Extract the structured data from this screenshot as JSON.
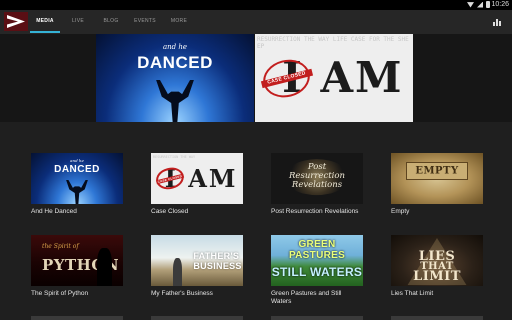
{
  "status_bar": {
    "time": "10:26",
    "icons": [
      "wifi-icon",
      "signal-icon",
      "battery-icon"
    ]
  },
  "app_bar": {
    "logo": "app-logo-icon",
    "tabs": [
      {
        "label": "MEDIA",
        "active": true
      },
      {
        "label": "LIVE",
        "active": false
      },
      {
        "label": "BLOG",
        "active": false
      },
      {
        "label": "EVENTS",
        "active": false
      },
      {
        "label": "MORE",
        "active": false
      }
    ],
    "action_icon": "bar-chart-icon",
    "accent_color": "#35b2d5"
  },
  "featured": [
    {
      "art_small": "and he",
      "art_big": "DANCED"
    },
    {
      "art_big": "I AM",
      "stamp": "CASE CLOSED",
      "background_words": "RESURRECTION THE WAY LIFE CASE FOR THE SHEEP"
    }
  ],
  "media_items": [
    {
      "title": "And He Danced",
      "art_small": "and he",
      "art_big": "DANCED"
    },
    {
      "title": "Case Closed",
      "art_big": "I AM",
      "stamp": "CASE CLOSED",
      "background_words": "RESURRECTION THE WAY"
    },
    {
      "title": "Post Resurrection Revelations",
      "art_lines": [
        "Post",
        "Resurrection",
        "Revelations"
      ]
    },
    {
      "title": "Empty",
      "art_big": "EMPTY"
    },
    {
      "title": "The Spirit of Python",
      "art_small": "the Spirit of",
      "art_big": "PYTHON"
    },
    {
      "title": "My Father's Business",
      "art_lines": [
        "FATHER'S",
        "BUSINESS"
      ]
    },
    {
      "title": "Green Pastures and Still Waters",
      "art_lines": [
        "GREEN PASTURES",
        "STILL WATERS"
      ]
    },
    {
      "title": "Lies That Limit",
      "art_lines": [
        "LIES",
        "THAT",
        "LIMIT"
      ]
    }
  ]
}
